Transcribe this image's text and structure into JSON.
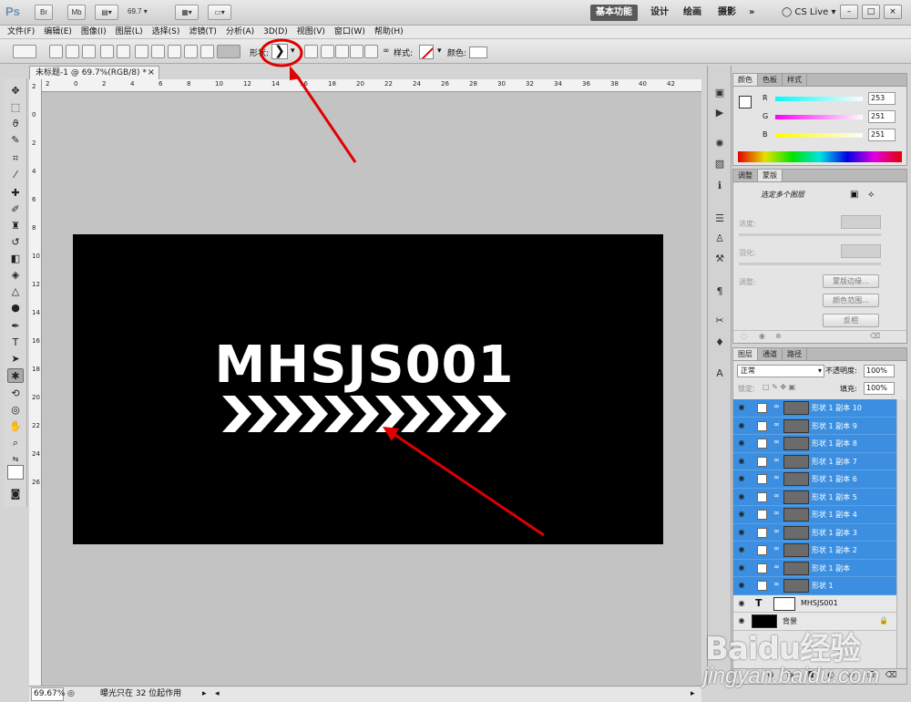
{
  "app": {
    "logo_text": "Ps",
    "br_label": "Br",
    "mb_label": "Mb",
    "zoom_select": "69.7",
    "workspaces": [
      "基本功能",
      "设计",
      "绘画",
      "摄影"
    ],
    "more_label": "»",
    "cs_live": "CS Live",
    "window_buttons": [
      "–",
      "□",
      "×"
    ]
  },
  "menu": {
    "items": [
      "文件(F)",
      "编辑(E)",
      "图像(I)",
      "图层(L)",
      "选择(S)",
      "滤镜(T)",
      "分析(A)",
      "3D(D)",
      "视图(V)",
      "窗口(W)",
      "帮助(H)"
    ]
  },
  "options": {
    "shape_label": "形状:",
    "shape_glyph": "❯",
    "style_label": "样式:",
    "color_label": "颜色:"
  },
  "document": {
    "tab_title": "未标题-1 @ 69.7%(RGB/8) *",
    "tab_close": "×",
    "canvas_text": "MHSJS001",
    "chevron_count": 11,
    "ruler_top": [
      "2",
      "0",
      "2",
      "4",
      "6",
      "8",
      "10",
      "12",
      "14",
      "16",
      "18",
      "20",
      "22",
      "24",
      "26",
      "28",
      "30",
      "32",
      "34",
      "36",
      "38",
      "40",
      "42"
    ],
    "ruler_left": [
      "2",
      "0",
      "2",
      "4",
      "6",
      "8",
      "10",
      "12",
      "14",
      "16",
      "18",
      "20",
      "22",
      "24",
      "26"
    ]
  },
  "status": {
    "zoom": "69.67%",
    "message": "曝光只在 32 位起作用"
  },
  "color_panel": {
    "tabs": [
      "颜色",
      "色板",
      "样式"
    ],
    "r_label": "R",
    "g_label": "G",
    "b_label": "B",
    "r_value": "253",
    "g_value": "251",
    "b_value": "251"
  },
  "adjust_panel": {
    "tabs": [
      "调整",
      "蒙版"
    ],
    "heading": "选定多个图层",
    "density_label": "浓度:",
    "feather_label": "羽化:",
    "refine_label": "调整:",
    "mask_edge_button": "蒙版边缘...",
    "color_range_button": "颜色范围...",
    "invert_button": "反相"
  },
  "layers_panel": {
    "tabs": [
      "图层",
      "通道",
      "路径"
    ],
    "blend_mode": "正常",
    "opacity_label": "不透明度:",
    "opacity_value": "100%",
    "lock_label": "锁定:",
    "fill_label": "填充:",
    "fill_value": "100%",
    "layers": [
      {
        "name": "形状 1 副本 10",
        "selected": true
      },
      {
        "name": "形状 1 副本 9",
        "selected": true
      },
      {
        "name": "形状 1 副本 8",
        "selected": true
      },
      {
        "name": "形状 1 副本 7",
        "selected": true
      },
      {
        "name": "形状 1 副本 6",
        "selected": true
      },
      {
        "name": "形状 1 副本 5",
        "selected": true
      },
      {
        "name": "形状 1 副本 4",
        "selected": true
      },
      {
        "name": "形状 1 副本 3",
        "selected": true
      },
      {
        "name": "形状 1 副本 2",
        "selected": true
      },
      {
        "name": "形状 1 副本",
        "selected": true
      },
      {
        "name": "形状 1",
        "selected": true
      },
      {
        "name": "MHSJS001",
        "selected": false,
        "type": "text"
      },
      {
        "name": "背景",
        "selected": false,
        "type": "background"
      }
    ]
  },
  "watermark": {
    "logo": "Baidu经验",
    "url": "jingyan.baidu.com"
  },
  "colors": {
    "selection_blue": "#3c8fe0",
    "annotation_red": "#e00000",
    "canvas_black": "#000000"
  }
}
